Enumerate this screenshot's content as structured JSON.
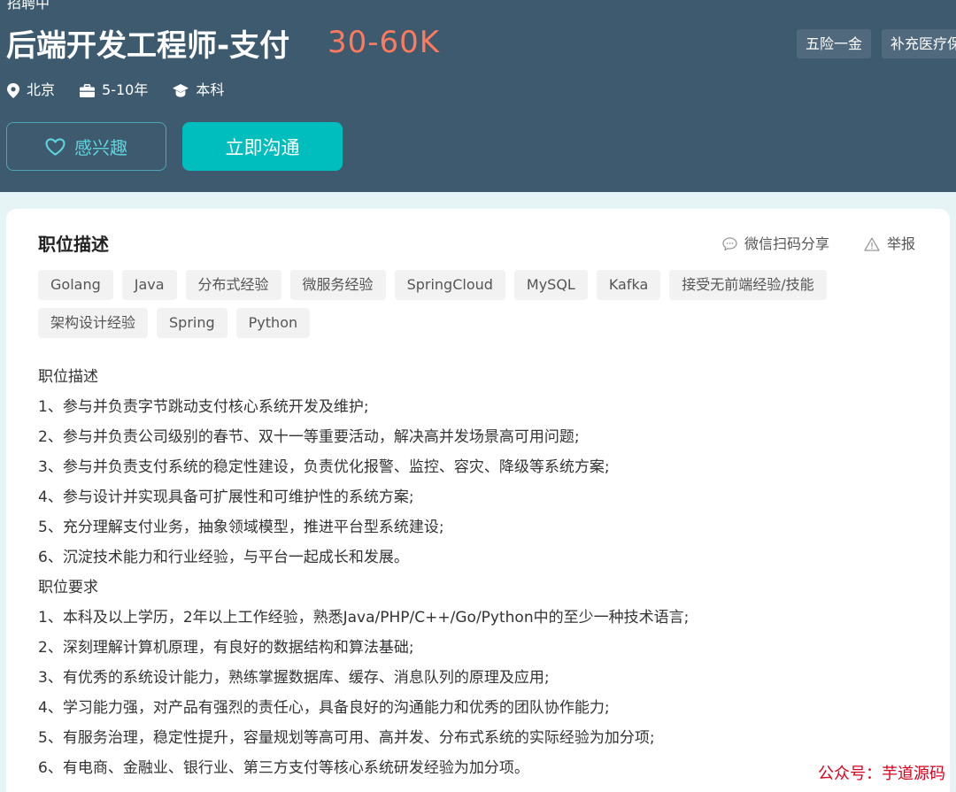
{
  "header": {
    "top_cut_text": "招聘中",
    "title": "后端开发工程师-支付",
    "salary": "30-60K",
    "welfare": [
      "五险一金",
      "补充医疗保"
    ],
    "meta": {
      "city": "北京",
      "experience": "5-10年",
      "degree": "本科"
    },
    "buttons": {
      "interest": "感兴趣",
      "chat": "立即沟通"
    }
  },
  "card": {
    "title": "职位描述",
    "share": "微信扫码分享",
    "report": "举报",
    "tags": [
      "Golang",
      "Java",
      "分布式经验",
      "微服务经验",
      "SpringCloud",
      "MySQL",
      "Kafka",
      "接受无前端经验/技能",
      "架构设计经验",
      "Spring",
      "Python"
    ],
    "lines": [
      "职位描述",
      "1、参与并负责字节跳动支付核心系统开发及维护;",
      "2、参与并负责公司级别的春节、双十一等重要活动，解决高并发场景高可用问题;",
      "3、参与并负责支付系统的稳定性建设，负责优化报警、监控、容灾、降级等系统方案;",
      "4、参与设计并实现具备可扩展性和可维护性的系统方案;",
      "5、充分理解支付业务，抽象领域模型，推进平台型系统建设;",
      "6、沉淀技术能力和行业经验，与平台一起成长和发展。",
      "职位要求",
      "1、本科及以上学历，2年以上工作经验，熟悉Java/PHP/C++/Go/Python中的至少一种技术语言;",
      "2、深刻理解计算机原理，有良好的数据结构和算法基础;",
      "3、有优秀的系统设计能力，熟练掌握数据库、缓存、消息队列的原理及应用;",
      "4、学习能力强，对产品有强烈的责任心，具备良好的沟通能力和优秀的团队协作能力;",
      "5、有服务治理，稳定性提升，容量规划等高可用、高并发、分布式系统的实际经验为加分项;",
      "6、有电商、金融业、银行业、第三方支付等核心系统研发经验为加分项。"
    ]
  },
  "watermark": "公众号：芋道源码"
}
